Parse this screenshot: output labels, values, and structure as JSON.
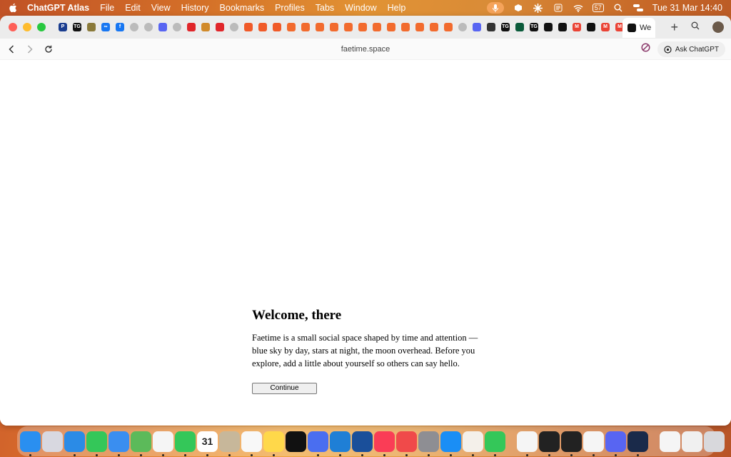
{
  "menubar": {
    "app": "ChatGPT Atlas",
    "items": [
      "File",
      "Edit",
      "View",
      "History",
      "Bookmarks",
      "Profiles",
      "Tabs",
      "Window",
      "Help"
    ],
    "datetime": "Tue 31 Mar  14:40",
    "battery": "57"
  },
  "tabs": {
    "favicons": [
      {
        "icon": "paypal-icon",
        "color": "#1a3d8f",
        "txt": "P"
      },
      {
        "icon": "tg-icon",
        "color": "#111",
        "txt": "TG"
      },
      {
        "icon": "doc-icon",
        "color": "#8a7a3a",
        "txt": ""
      },
      {
        "icon": "meta-icon",
        "color": "#1877f2",
        "txt": "∞"
      },
      {
        "icon": "facebook-icon",
        "color": "#1877f2",
        "txt": "f"
      },
      {
        "icon": "globe-icon",
        "color": "#bbb",
        "txt": ""
      },
      {
        "icon": "globe-icon",
        "color": "#bbb",
        "txt": ""
      },
      {
        "icon": "discord-icon",
        "color": "#5865f2",
        "txt": ""
      },
      {
        "icon": "globe-icon",
        "color": "#bbb",
        "txt": ""
      },
      {
        "icon": "opera-icon",
        "color": "#e0262a",
        "txt": ""
      },
      {
        "icon": "crown-icon",
        "color": "#d18a2a",
        "txt": ""
      },
      {
        "icon": "opera-icon",
        "color": "#e0262a",
        "txt": ""
      },
      {
        "icon": "globe-icon",
        "color": "#bbb",
        "txt": ""
      },
      {
        "icon": "chart-icon",
        "color": "#f05a28",
        "txt": ""
      },
      {
        "icon": "chart-icon",
        "color": "#f05a28",
        "txt": ""
      },
      {
        "icon": "chart-icon",
        "color": "#f05a28",
        "txt": ""
      },
      {
        "icon": "link-icon",
        "color": "#f26b2e",
        "txt": ""
      },
      {
        "icon": "link-icon",
        "color": "#f26b2e",
        "txt": ""
      },
      {
        "icon": "link-icon",
        "color": "#f26b2e",
        "txt": ""
      },
      {
        "icon": "link-icon",
        "color": "#f26b2e",
        "txt": ""
      },
      {
        "icon": "link-icon",
        "color": "#f26b2e",
        "txt": ""
      },
      {
        "icon": "link-icon",
        "color": "#f26b2e",
        "txt": ""
      },
      {
        "icon": "link-icon",
        "color": "#f26b2e",
        "txt": ""
      },
      {
        "icon": "link-icon",
        "color": "#f26b2e",
        "txt": ""
      },
      {
        "icon": "link-icon",
        "color": "#f26b2e",
        "txt": ""
      },
      {
        "icon": "link-icon",
        "color": "#f26b2e",
        "txt": ""
      },
      {
        "icon": "link-icon",
        "color": "#f26b2e",
        "txt": ""
      },
      {
        "icon": "link-icon",
        "color": "#f26b2e",
        "txt": ""
      },
      {
        "icon": "globe-icon",
        "color": "#bbb",
        "txt": ""
      },
      {
        "icon": "discord-icon",
        "color": "#5865f2",
        "txt": ""
      },
      {
        "icon": "openai-icon",
        "color": "#333",
        "txt": ""
      },
      {
        "icon": "tg-icon",
        "color": "#111",
        "txt": "TG"
      },
      {
        "icon": "circle-icon",
        "color": "#0a5a3a",
        "txt": ""
      },
      {
        "icon": "tg-icon",
        "color": "#111",
        "txt": "TG"
      },
      {
        "icon": "app-icon",
        "color": "#111",
        "txt": ""
      },
      {
        "icon": "app-icon",
        "color": "#111",
        "txt": ""
      },
      {
        "icon": "gmail-icon",
        "color": "#ea4335",
        "txt": "M"
      },
      {
        "icon": "app-icon",
        "color": "#111",
        "txt": ""
      },
      {
        "icon": "gmail-icon",
        "color": "#ea4335",
        "txt": "M"
      },
      {
        "icon": "gmail-icon",
        "color": "#ea4335",
        "txt": "M"
      }
    ],
    "active_label": "We"
  },
  "toolbar": {
    "url": "faetime.space",
    "ask_label": "Ask ChatGPT"
  },
  "page": {
    "heading": "Welcome, there",
    "body": "Faetime is a small social space shaped by time and attention — blue sky by day, stars at night, the moon overhead. Before you explore, add a little about yourself so others can say hello.",
    "button": "Continue"
  },
  "dock": {
    "calendar_day": "31",
    "apps": [
      {
        "name": "finder-icon",
        "color": "#2a8ff0"
      },
      {
        "name": "launchpad-icon",
        "color": "#d8d8e0"
      },
      {
        "name": "safari-icon",
        "color": "#2b8be6"
      },
      {
        "name": "messages-icon",
        "color": "#34c759"
      },
      {
        "name": "mail-icon",
        "color": "#3a8ef0"
      },
      {
        "name": "maps-icon",
        "color": "#5cba5a"
      },
      {
        "name": "photos-icon",
        "color": "#f5f5f5"
      },
      {
        "name": "facetime-icon",
        "color": "#34c759"
      },
      {
        "name": "calendar-icon",
        "color": "#ffffff"
      },
      {
        "name": "contacts-icon",
        "color": "#c7b79a"
      },
      {
        "name": "reminders-icon",
        "color": "#f8f8f8"
      },
      {
        "name": "notes-icon",
        "color": "#ffd84a"
      },
      {
        "name": "appletv-icon",
        "color": "#111"
      },
      {
        "name": "simulator-icon",
        "color": "#4a6ef0"
      },
      {
        "name": "vscode-icon",
        "color": "#1f7fd6"
      },
      {
        "name": "testflight-icon",
        "color": "#1a4f9a"
      },
      {
        "name": "music-icon",
        "color": "#fa3d56"
      },
      {
        "name": "rocket-icon",
        "color": "#f04a4a"
      },
      {
        "name": "settings-icon",
        "color": "#8e8e93"
      },
      {
        "name": "appstore-icon",
        "color": "#1a8ef5"
      },
      {
        "name": "perplexity-icon",
        "color": "#f4f0ea"
      },
      {
        "name": "phone-icon",
        "color": "#34c759"
      },
      {
        "name": "chrome-icon",
        "color": "#f5f5f5"
      },
      {
        "name": "terminal-icon",
        "color": "#222"
      },
      {
        "name": "cube-icon",
        "color": "#222"
      },
      {
        "name": "inkscape-icon",
        "color": "#f5f5f5"
      },
      {
        "name": "discord-icon",
        "color": "#5865f2"
      },
      {
        "name": "arc-icon",
        "color": "#1a2a4a"
      },
      {
        "name": "document-icon",
        "color": "#f5f5f5"
      },
      {
        "name": "document-icon",
        "color": "#f0f0f0"
      },
      {
        "name": "trash-icon",
        "color": "#d8d8dc"
      }
    ]
  }
}
